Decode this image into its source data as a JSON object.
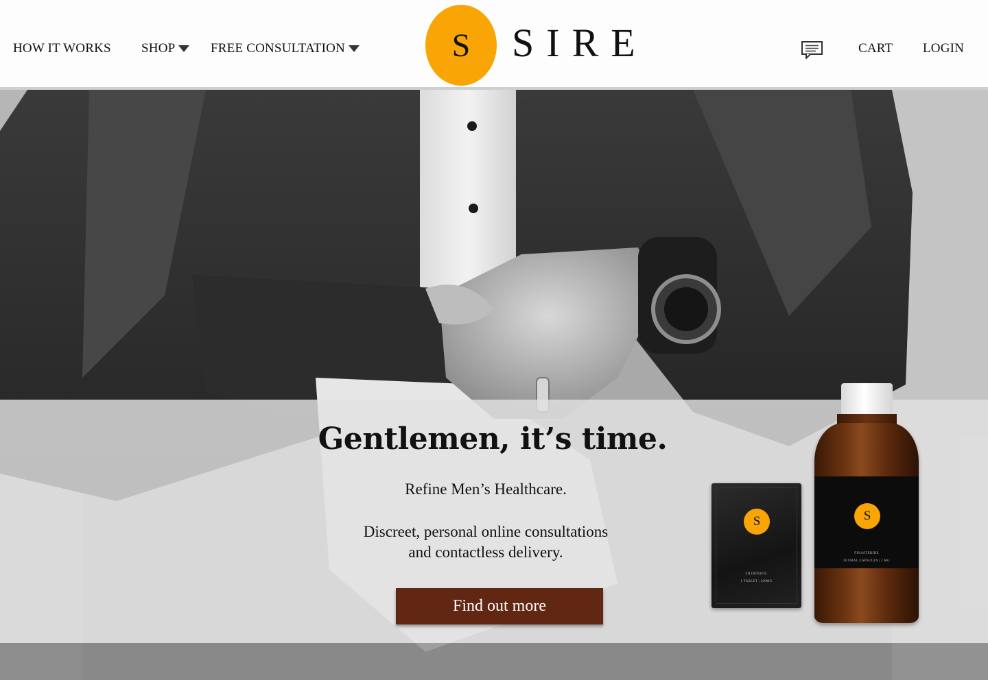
{
  "header": {
    "nav_left": {
      "how_it_works": "HOW IT WORKS",
      "shop": "SHOP",
      "free_consultation": "FREE CONSULTATION"
    },
    "logo": {
      "mark": "S",
      "wordmark": "SIRE"
    },
    "nav_right": {
      "cart": "CART",
      "login": "LOGIN"
    },
    "icons": {
      "chat": "chat-bubble-icon",
      "dropdown": "caret-down-icon"
    }
  },
  "hero": {
    "headline": "Gentlemen, it’s time.",
    "subheadline": "Refine Men’s Healthcare.",
    "body_line1": "Discreet, personal online consultations",
    "body_line2": "and contactless delivery.",
    "cta_label": "Find out more",
    "products": {
      "sachet_mark": "S",
      "sachet_line1": "SILDENAFIL",
      "sachet_line2": "1 TABLET | 100MG",
      "bottle_mark": "S",
      "bottle_line1": "FINASTERIDE",
      "bottle_line2": "30 ORAL CAPSULES | 1 MG"
    }
  },
  "colors": {
    "brand_orange": "#f8a505",
    "cta_background": "#622713",
    "cta_text": "#ffffff",
    "header_background": "#fdfdfd"
  }
}
